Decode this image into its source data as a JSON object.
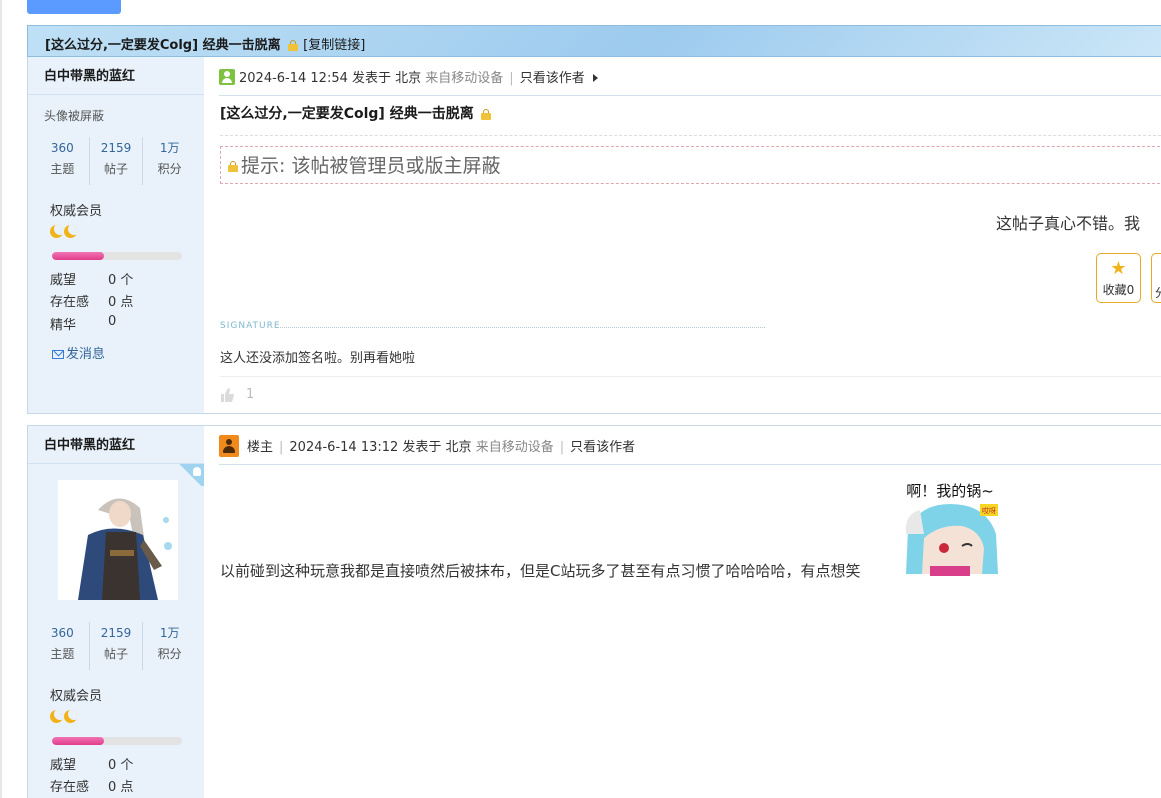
{
  "top_button": {
    "label": ""
  },
  "thread": {
    "title": "[这么过分,一定要发Colg] 经典一击脱离",
    "copy_link": "[复制链接]"
  },
  "posts": [
    {
      "author": {
        "name": "白中带黑的蓝红",
        "avatar_hidden": "头像被屏蔽",
        "stats": [
          {
            "num": "360",
            "label": "主题"
          },
          {
            "num": "2159",
            "label": "帖子"
          },
          {
            "num": "1万",
            "label": "积分"
          }
        ],
        "rank": "权威会员",
        "rank_progress": 0.4,
        "attrs": [
          {
            "label": "威望",
            "value": "0 个"
          },
          {
            "label": "存在感",
            "value": "0 点"
          },
          {
            "label": "精华",
            "value": "0"
          }
        ],
        "send_message": "发消息"
      },
      "meta": {
        "time": "2024-6-14 12:54 发表于 北京",
        "source": "来自移动设备",
        "only_author": "只看该作者"
      },
      "title": "[这么过分,一定要发Colg] 经典一击脱离",
      "notice": "提示: 该帖被管理员或版主屏蔽",
      "body_partial": "这帖子真心不错。我",
      "favorite_label": "收藏0",
      "share_label": "分",
      "signature_label": "SIGNATURE",
      "signature_text": "这人还没添加签名啦。别再看她啦",
      "like_count": "1"
    },
    {
      "author": {
        "name": "白中带黑的蓝红",
        "stats": [
          {
            "num": "360",
            "label": "主题"
          },
          {
            "num": "2159",
            "label": "帖子"
          },
          {
            "num": "1万",
            "label": "积分"
          }
        ],
        "rank": "权威会员",
        "rank_progress": 0.4,
        "attrs": [
          {
            "label": "威望",
            "value": "0 个"
          },
          {
            "label": "存在感",
            "value": "0 点"
          }
        ]
      },
      "meta": {
        "owner": "楼主",
        "time": "2024-6-14 13:12 发表于 北京",
        "source": "来自移动设备",
        "only_author": "只看该作者"
      },
      "body": "以前碰到这种玩意我都是直接喷然后被抹布，但是C站玩多了甚至有点习惯了哈哈哈哈，有点想笑",
      "sticker_text": "啊！我的锅~",
      "sticker_tag": "哎呀"
    }
  ],
  "colors": {
    "accent": "#336699",
    "side_bg": "#e9f2fb",
    "rank_bar": "#e23c8b",
    "moon": "#f2b21a"
  }
}
